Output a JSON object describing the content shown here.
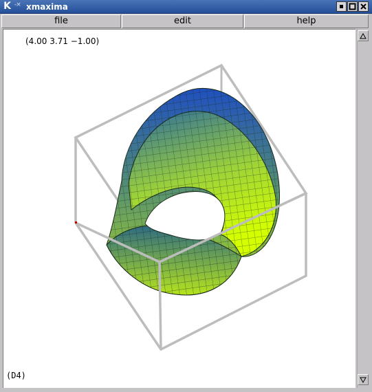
{
  "window": {
    "title": "xmaxima",
    "logo": "K",
    "sysmenu": "-×",
    "buttons": [
      "minimize-icon",
      "maximize-icon",
      "close-icon"
    ]
  },
  "menu": {
    "items": [
      {
        "label": "file"
      },
      {
        "label": "edit"
      },
      {
        "label": "help"
      }
    ]
  },
  "plot": {
    "view_point": "(4.00 3.71 −1.00)",
    "output_label": "(D4)",
    "colors": {
      "surface_top": "#1a4fb8",
      "surface_bottom": "#c8f000",
      "box": "#bdbdbd",
      "mesh": "#1a2a1a"
    }
  }
}
